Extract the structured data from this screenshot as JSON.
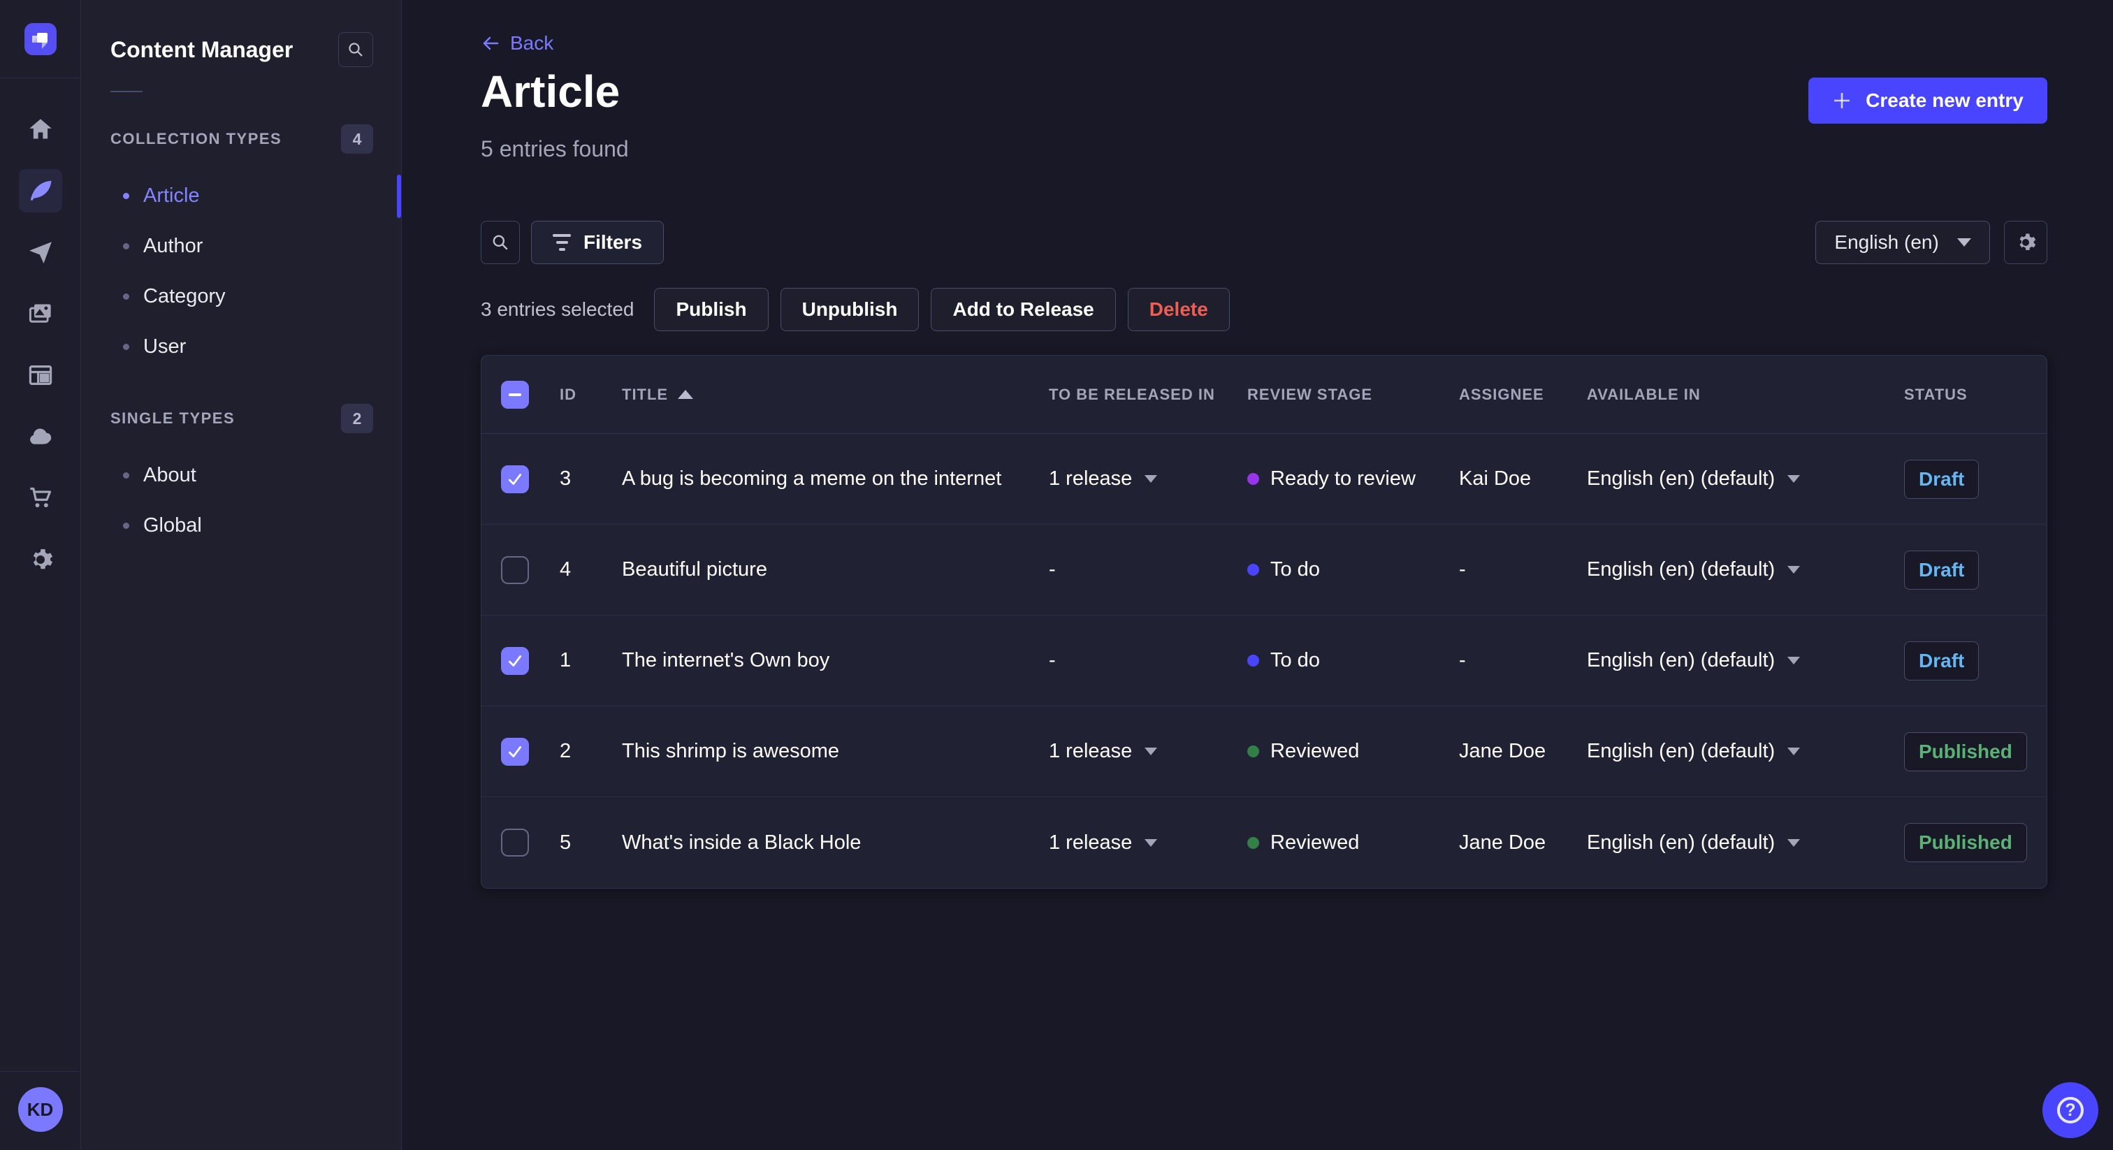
{
  "theme": {
    "bg_main": "#181826",
    "bg_surface": "#212134",
    "accent_primary": "#4945ff",
    "accent_light": "#7b79ff",
    "text_muted": "#a5a5ba",
    "danger": "#ee5e52",
    "draft_color": "#66b7f1",
    "published_color": "#5cb176",
    "stage_todo": "#4945ff",
    "stage_ready": "#9736e8",
    "stage_reviewed": "#328048"
  },
  "rail": {
    "icons": [
      "strapi-logo",
      "home",
      "content-manager",
      "releases",
      "media-library",
      "content-type-builder",
      "deploy",
      "purchases",
      "settings"
    ],
    "avatar_initials": "KD"
  },
  "sidebar": {
    "title": "Content Manager",
    "sections": [
      {
        "label": "COLLECTION TYPES",
        "count": "4",
        "items": [
          {
            "label": "Article",
            "active": true
          },
          {
            "label": "Author"
          },
          {
            "label": "Category"
          },
          {
            "label": "User"
          }
        ]
      },
      {
        "label": "SINGLE TYPES",
        "count": "2",
        "items": [
          {
            "label": "About"
          },
          {
            "label": "Global"
          }
        ]
      }
    ]
  },
  "header": {
    "back_label": "Back",
    "title": "Article",
    "subtitle": "5 entries found",
    "create_label": "Create new entry"
  },
  "toolbar": {
    "filters_label": "Filters",
    "locale_value": "English (en)"
  },
  "selection": {
    "label": "3 entries selected",
    "publish_label": "Publish",
    "unpublish_label": "Unpublish",
    "add_to_release_label": "Add to Release",
    "delete_label": "Delete"
  },
  "table": {
    "columns": [
      "ID",
      "TITLE",
      "TO BE RELEASED IN",
      "REVIEW STAGE",
      "ASSIGNEE",
      "AVAILABLE IN",
      "STATUS"
    ],
    "sorted_column": "TITLE",
    "sort_direction": "asc",
    "rows": [
      {
        "checked": true,
        "id": "3",
        "title": "A bug is becoming a meme on the internet",
        "release": "1 release",
        "stage": "Ready to review",
        "stage_color": "#9736e8",
        "assignee": "Kai Doe",
        "locale": "English (en) (default)",
        "status": "Draft",
        "status_color": "#66b7f1"
      },
      {
        "checked": false,
        "id": "4",
        "title": "Beautiful picture",
        "release": "-",
        "stage": "To do",
        "stage_color": "#4945ff",
        "assignee": "-",
        "locale": "English (en) (default)",
        "status": "Draft",
        "status_color": "#66b7f1"
      },
      {
        "checked": true,
        "id": "1",
        "title": "The internet's Own boy",
        "release": "-",
        "stage": "To do",
        "stage_color": "#4945ff",
        "assignee": "-",
        "locale": "English (en) (default)",
        "status": "Draft",
        "status_color": "#66b7f1"
      },
      {
        "checked": true,
        "id": "2",
        "title": "This shrimp is awesome",
        "release": "1 release",
        "stage": "Reviewed",
        "stage_color": "#328048",
        "assignee": "Jane Doe",
        "locale": "English (en) (default)",
        "status": "Published",
        "status_color": "#5cb176"
      },
      {
        "checked": false,
        "id": "5",
        "title": "What's inside a Black Hole",
        "release": "1 release",
        "stage": "Reviewed",
        "stage_color": "#328048",
        "assignee": "Jane Doe",
        "locale": "English (en) (default)",
        "status": "Published",
        "status_color": "#5cb176"
      }
    ]
  },
  "help": {
    "glyph": "?"
  }
}
